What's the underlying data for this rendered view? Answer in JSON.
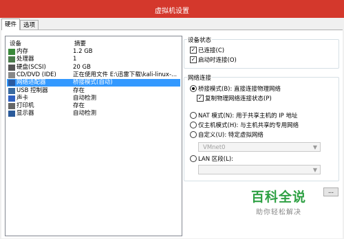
{
  "window": {
    "title": "虚拟机设置"
  },
  "tabs": [
    {
      "label": "硬件"
    },
    {
      "label": "选项"
    }
  ],
  "devices": {
    "col_device": "设备",
    "col_summary": "摘要",
    "rows": [
      {
        "name": "内存",
        "summary": "1.2 GB",
        "icon": "memory-icon",
        "color": "#3a8a3a"
      },
      {
        "name": "处理器",
        "summary": "1",
        "icon": "cpu-icon",
        "color": "#4a7a4a"
      },
      {
        "name": "硬盘(SCSI)",
        "summary": "20 GB",
        "icon": "hard-disk-icon",
        "color": "#555555"
      },
      {
        "name": "CD/DVD (IDE)",
        "summary": "正在使用文件 E:\\迅雷下载\\kali-linux-...",
        "icon": "cd-dvd-icon",
        "color": "#888888"
      },
      {
        "name": "网络适配器",
        "summary": "桥接模式(自动)",
        "icon": "network-adapter-icon",
        "color": "#2a5aa0"
      },
      {
        "name": "USB 控制器",
        "summary": "存在",
        "icon": "usb-icon",
        "color": "#3a6aa0"
      },
      {
        "name": "声卡",
        "summary": "自动检测",
        "icon": "sound-card-icon",
        "color": "#3060c0"
      },
      {
        "name": "打印机",
        "summary": "存在",
        "icon": "printer-icon",
        "color": "#666666"
      },
      {
        "name": "显示器",
        "summary": "自动检测",
        "icon": "monitor-icon",
        "color": "#2a5a9a"
      }
    ],
    "selected_index": 4
  },
  "device_status": {
    "label": "设备状态",
    "connected": {
      "label": "已连接(C)",
      "checked": true
    },
    "connect_on_power": {
      "label": "启动时连接(O)",
      "checked": true
    }
  },
  "network": {
    "label": "网络连接",
    "bridged": {
      "label": "桥接模式(B): 直接连接物理网络",
      "selected": true
    },
    "replicate": {
      "label": "复制物理网络连接状态(P)",
      "checked": true
    },
    "nat": {
      "label": "NAT 模式(N): 用于共享主机的 IP 地址"
    },
    "host_only": {
      "label": "仅主机模式(H): 与主机共享的专用网络"
    },
    "custom": {
      "label": "自定义(U): 特定虚拟网络"
    },
    "vmnet_value": "VMnet0",
    "lan": {
      "label": "LAN 区段(L):"
    },
    "advanced_button": "..."
  },
  "watermark": {
    "title": "百科全说",
    "subtitle": "助你轻松解决"
  },
  "colors": {
    "titlebar": "#d4382c",
    "selection": "#3399ff"
  }
}
